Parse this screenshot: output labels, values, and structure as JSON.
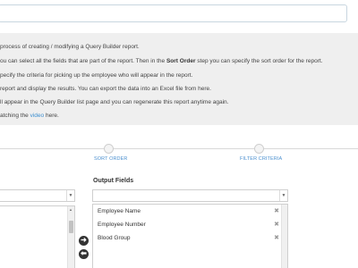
{
  "info": {
    "line1": "process of creating / modifying a Query Builder report.",
    "line2_pre": "ou can select all the fields that are part of the report. Then in the ",
    "line2_bold": "Sort Order",
    "line2_post": " step you can specify the sort order for the report.",
    "line3": "pecify the criteria for picking up the employee who will appear in the report.",
    "line4": "report and display the results. You can export the data into an Excel file from here.",
    "line5": "ll appear in the Query Builder list page and you can regenerate this report anytime again.",
    "line6_pre": "atching the ",
    "line6_link": "video",
    "line6_post": " here."
  },
  "steps": {
    "sort_order": "SORT ORDER",
    "filter_criteria": "FILTER CRITERIA"
  },
  "output": {
    "title": "Output Fields",
    "fields": [
      {
        "name": "Employee Name",
        "remove": "✖"
      },
      {
        "name": "Employee Number",
        "remove": "✖"
      },
      {
        "name": "Blood Group",
        "remove": "✖"
      }
    ]
  },
  "icons": {
    "move_right": "➜",
    "move_left": "⬅",
    "caret": "▼",
    "scroll_up": "▲"
  },
  "colors": {
    "link": "#3d8fd0",
    "panel_bg": "#efefef",
    "step_label": "#4a8fcf"
  }
}
